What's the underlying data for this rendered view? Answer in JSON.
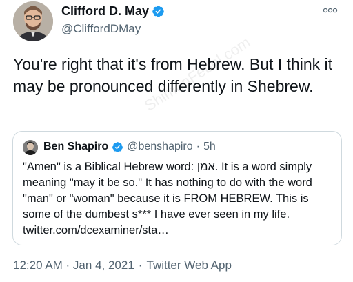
{
  "tweet": {
    "author_name": "Clifford D. May",
    "author_handle": "@CliffordDMay",
    "text": "You're right that it's from Hebrew. But I think it may be pronounced differently in Shebrew.",
    "timestamp": "12:20 AM · Jan 4, 2021",
    "separator": "·",
    "source_app": "Twitter Web App"
  },
  "quoted_tweet": {
    "author_name": "Ben Shapiro",
    "author_handle": "@benshapiro",
    "separator": "·",
    "time": "5h",
    "text": "\"Amen\" is a Biblical Hebrew word: אמן. It is a word simply meaning \"may it be so.\" It has nothing to do with the word \"man\" or \"woman\" because it is FROM HEBREW. This is some of the dumbest s*** I have ever seen in my life. twitter.com/dcexaminer/sta…"
  },
  "icons": {
    "verified": "verified-badge-icon",
    "more": "more-options-icon"
  },
  "colors": {
    "verified_blue": "#1d9bf0",
    "secondary_text": "#536471",
    "border": "#cfd9de"
  },
  "watermark": "ShimonFebel.com"
}
